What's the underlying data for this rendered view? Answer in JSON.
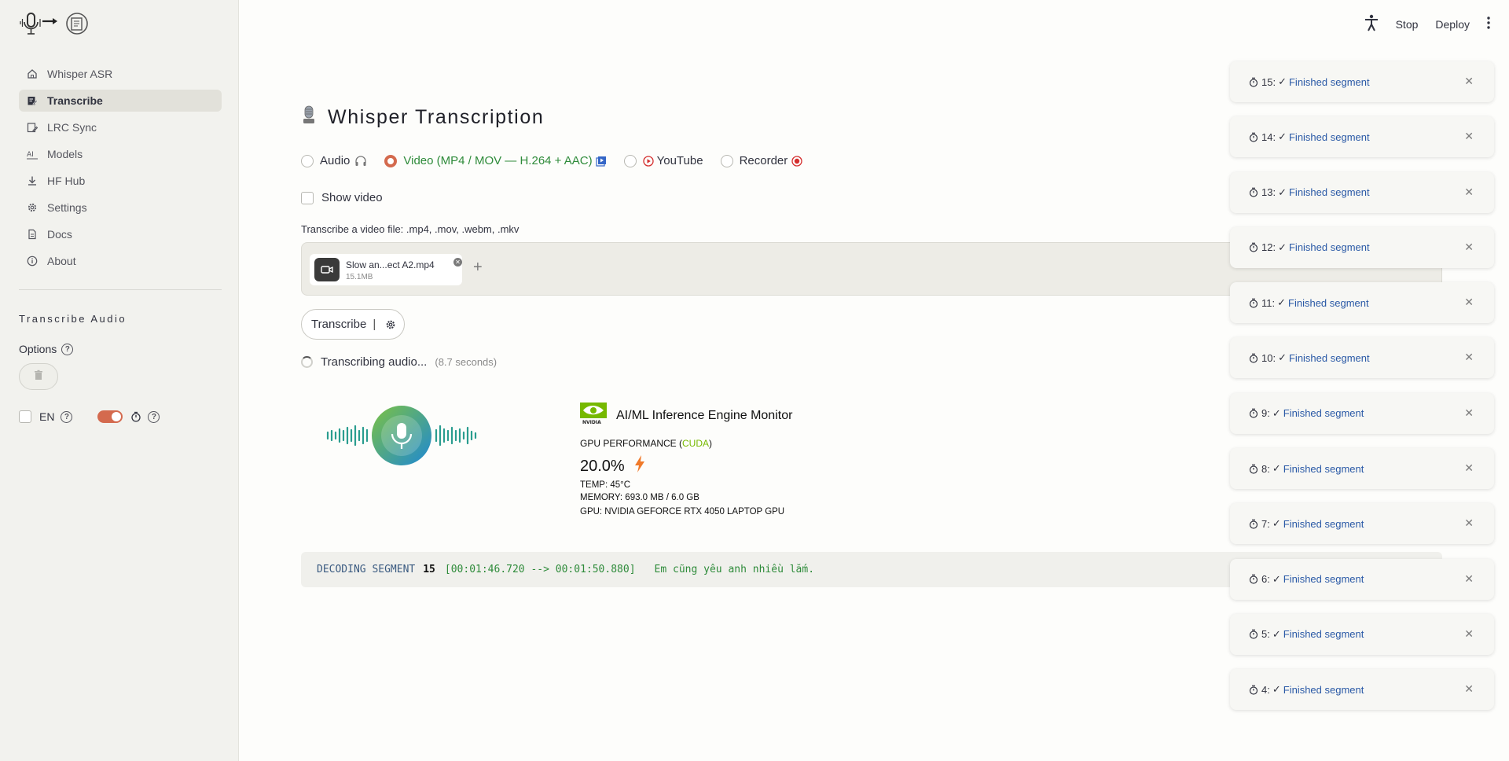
{
  "sidebar": {
    "items": [
      {
        "label": "Whisper ASR",
        "icon": "home-icon",
        "active": false
      },
      {
        "label": "Transcribe",
        "icon": "edit-note-icon",
        "active": true
      },
      {
        "label": "LRC Sync",
        "icon": "sync-doc-icon",
        "active": false
      },
      {
        "label": "Models",
        "icon": "ai-icon",
        "active": false
      },
      {
        "label": "HF Hub",
        "icon": "download-icon",
        "active": false
      },
      {
        "label": "Settings",
        "icon": "gear-icon",
        "active": false
      },
      {
        "label": "Docs",
        "icon": "document-icon",
        "active": false
      },
      {
        "label": "About",
        "icon": "info-icon",
        "active": false
      }
    ],
    "section_title": "Transcribe Audio",
    "options_label": "Options",
    "lang_label": "EN"
  },
  "topbar": {
    "stop": "Stop",
    "deploy": "Deploy"
  },
  "main": {
    "title": "Whisper Transcription",
    "radios": [
      {
        "label": "Audio",
        "selected": false
      },
      {
        "label": "Video (MP4 / MOV — H.264 + AAC)",
        "selected": true
      },
      {
        "label": "YouTube",
        "selected": false
      },
      {
        "label": "Recorder",
        "selected": false
      }
    ],
    "show_video": "Show video",
    "upload_label": "Transcribe a video file: .mp4, .mov, .webm, .mkv",
    "file": {
      "name": "Slow an...ect A2.mp4",
      "size": "15.1MB"
    },
    "transcribe_button": "Transcribe",
    "status": "Transcribing audio...",
    "status_time": "(8.7 seconds)"
  },
  "gpu": {
    "title": "AI/ML Inference Engine Monitor",
    "perf_label": "GPU PERFORMANCE (",
    "perf_cuda": "CUDA",
    "perf_close": ")",
    "percent": "20.0%",
    "temp": "TEMP: 45°C",
    "memory": "MEMORY: 693.0 MB / 6.0 GB",
    "gpu_name": "GPU: NVIDIA GEFORCE RTX 4050 LAPTOP GPU"
  },
  "decode": {
    "label": "DECODING SEGMENT",
    "segment": "15",
    "time": "[00:01:46.720 --> 00:01:50.880]",
    "text": "Em cũng yêu anh nhiều lắm."
  },
  "toasts": [
    {
      "num": "15:",
      "msg": "Finished segment"
    },
    {
      "num": "14:",
      "msg": "Finished segment"
    },
    {
      "num": "13:",
      "msg": "Finished segment"
    },
    {
      "num": "12:",
      "msg": "Finished segment"
    },
    {
      "num": "11:",
      "msg": "Finished segment"
    },
    {
      "num": "10:",
      "msg": "Finished segment"
    },
    {
      "num": "9:",
      "msg": "Finished segment"
    },
    {
      "num": "8:",
      "msg": "Finished segment"
    },
    {
      "num": "7:",
      "msg": "Finished segment"
    },
    {
      "num": "6:",
      "msg": "Finished segment"
    },
    {
      "num": "5:",
      "msg": "Finished segment"
    },
    {
      "num": "4:",
      "msg": "Finished segment"
    }
  ],
  "colors": {
    "accent": "#d46a4e",
    "success": "#2e8b3a",
    "link": "#2a59a6",
    "nvidia": "#76b900"
  }
}
